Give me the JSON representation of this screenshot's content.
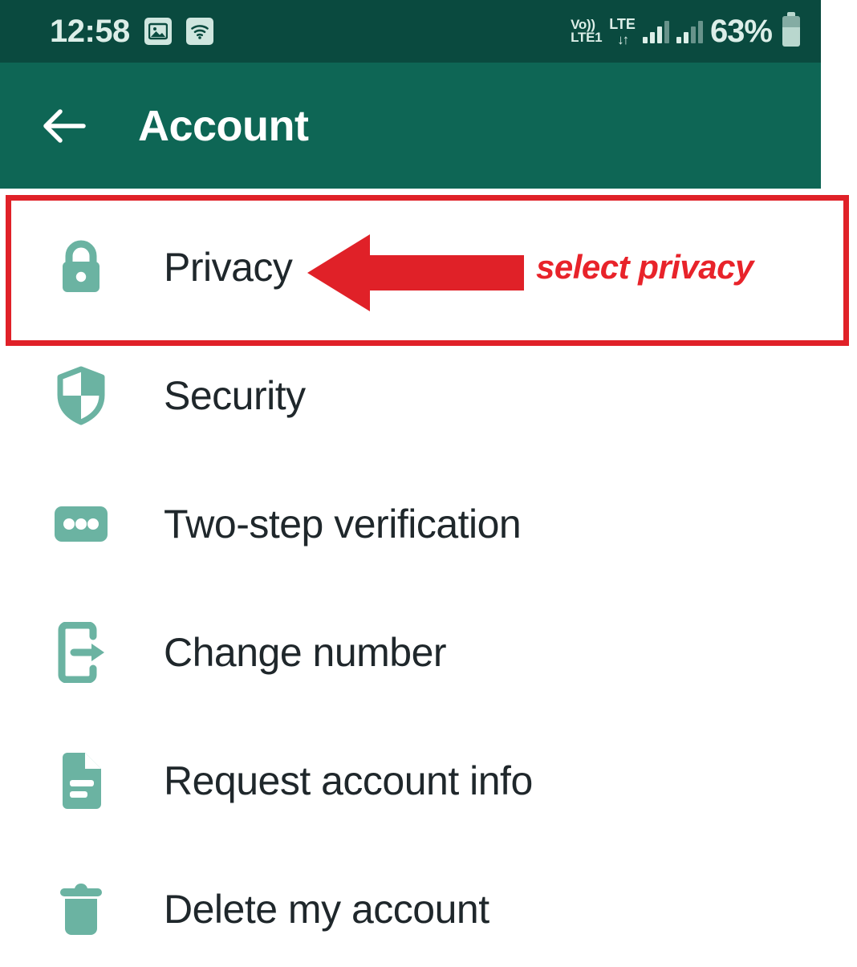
{
  "status_bar": {
    "time": "12:58",
    "icons": [
      "photo-icon",
      "wifi-icon"
    ],
    "volte_line1": "Vo))",
    "volte_line2": "LTE1",
    "network_type": "LTE",
    "data_arrows": "↓↑",
    "battery_percent": "63%",
    "background_color": "#0a4a3f"
  },
  "app_bar": {
    "back_label": "back-arrow",
    "title": "Account",
    "background_color": "#0e6655",
    "title_color": "#ffffff"
  },
  "list": {
    "items": [
      {
        "label": "Privacy",
        "icon": "lock-icon"
      },
      {
        "label": "Security",
        "icon": "shield-icon"
      },
      {
        "label": "Two-step verification",
        "icon": "password-dots-icon"
      },
      {
        "label": "Change number",
        "icon": "phone-exit-arrow-icon"
      },
      {
        "label": "Request account info",
        "icon": "document-icon"
      },
      {
        "label": "Delete my account",
        "icon": "trash-icon"
      }
    ],
    "icon_color": "#6bb3a2",
    "label_color": "#1f272b"
  },
  "annotation": {
    "callout_text": "select privacy",
    "color": "#e02128",
    "highlight_target": "Privacy",
    "arrow_direction": "left"
  }
}
